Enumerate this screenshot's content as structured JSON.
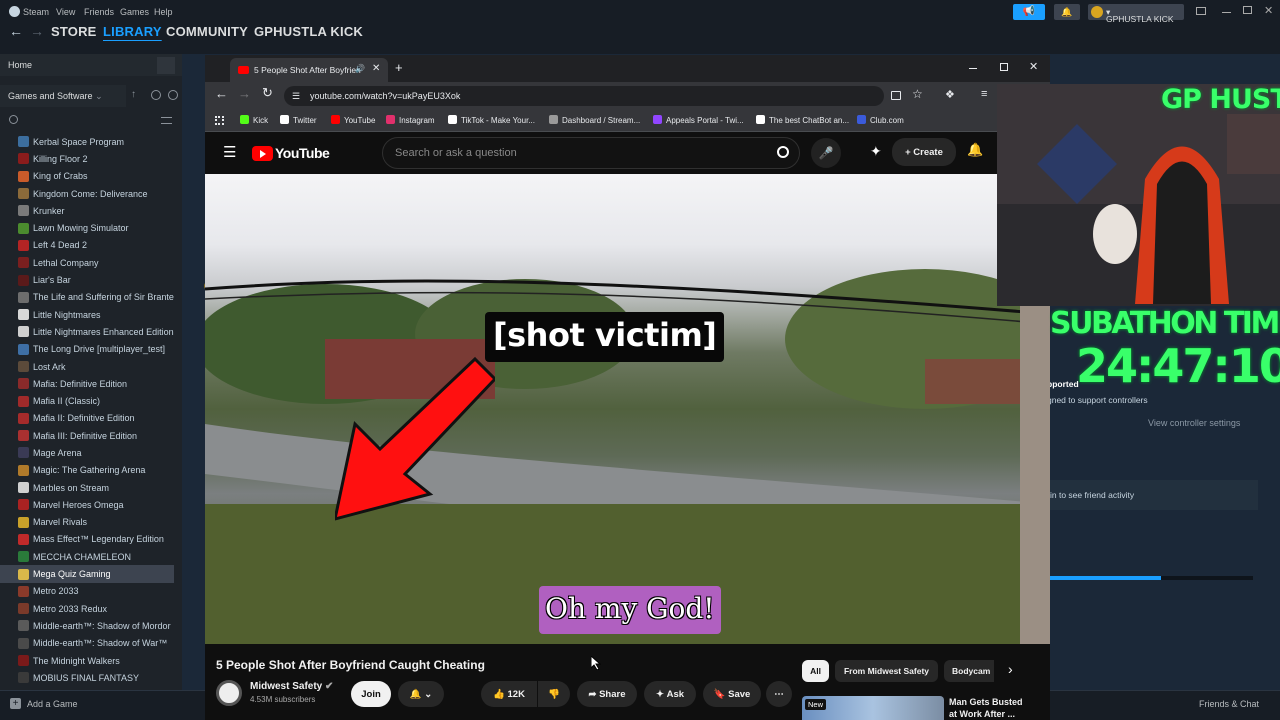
{
  "steam": {
    "menubar": [
      "Steam",
      "View",
      "Friends",
      "Games",
      "Help"
    ],
    "nav": [
      "STORE",
      "LIBRARY",
      "COMMUNITY",
      "GPHUSTLA KICK"
    ],
    "active_nav": "LIBRARY",
    "username": "GPHUSTLA KICK",
    "sidebar": {
      "home": "Home",
      "filter": "Games and Software",
      "games": [
        {
          "name": "Kerbal Space Program",
          "color": "#3c6e9e"
        },
        {
          "name": "Killing Floor 2",
          "color": "#8a1c1c"
        },
        {
          "name": "King of Crabs",
          "color": "#c95b2a"
        },
        {
          "name": "Kingdom Come: Deliverance",
          "color": "#8b6a3a"
        },
        {
          "name": "Krunker",
          "color": "#7a7a7a"
        },
        {
          "name": "Lawn Mowing Simulator",
          "color": "#4b8b2e"
        },
        {
          "name": "Left 4 Dead 2",
          "color": "#b32424"
        },
        {
          "name": "Lethal Company",
          "color": "#7a1f1f"
        },
        {
          "name": "Liar's Bar",
          "color": "#5a1a1a"
        },
        {
          "name": "The Life and Suffering of Sir Brante",
          "color": "#6d6d6d"
        },
        {
          "name": "Little Nightmares",
          "color": "#d8d8d8"
        },
        {
          "name": "Little Nightmares Enhanced Edition",
          "color": "#cfcfcf"
        },
        {
          "name": "The Long Drive [multiplayer_test]",
          "color": "#3e6fa5"
        },
        {
          "name": "Lost Ark",
          "color": "#5b4a3a"
        },
        {
          "name": "Mafia: Definitive Edition",
          "color": "#8a2a2a"
        },
        {
          "name": "Mafia II (Classic)",
          "color": "#a02a2a"
        },
        {
          "name": "Mafia II: Definitive Edition",
          "color": "#a52b2b"
        },
        {
          "name": "Mafia III: Definitive Edition",
          "color": "#a83030"
        },
        {
          "name": "Mage Arena",
          "color": "#3a3a55"
        },
        {
          "name": "Magic: The Gathering Arena",
          "color": "#b07a2a"
        },
        {
          "name": "Marbles on Stream",
          "color": "#d0d0d0"
        },
        {
          "name": "Marvel Heroes Omega",
          "color": "#a22"
        },
        {
          "name": "Marvel Rivals",
          "color": "#c9a12a"
        },
        {
          "name": "Mass Effect™ Legendary Edition",
          "color": "#c02a2a"
        },
        {
          "name": "MECCHA CHAMELEON",
          "color": "#2a7a3a"
        },
        {
          "name": "Mega Quiz Gaming",
          "color": "#d9b84a"
        },
        {
          "name": "Metro 2033",
          "color": "#8a3a2a"
        },
        {
          "name": "Metro 2033 Redux",
          "color": "#7a3a2a"
        },
        {
          "name": "Middle-earth™: Shadow of Mordor",
          "color": "#5a5a5a"
        },
        {
          "name": "Middle-earth™: Shadow of War™",
          "color": "#4a4a4a"
        },
        {
          "name": "The Midnight Walkers",
          "color": "#7a1a1a"
        },
        {
          "name": "MOBIUS FINAL FANTASY",
          "color": "#3a3a3a"
        }
      ],
      "selected_game": "Mega Quiz Gaming",
      "add_game": "Add a Game"
    },
    "right_panel": {
      "supported": "pported",
      "supported_sub": "gned to support controllers",
      "view_controller": "View controller settings",
      "friend_activity": "in to see friend activity",
      "friends_chat": "Friends & Chat",
      "progress": 0.55
    }
  },
  "browser": {
    "tab_title": "5 People Shot After Boyfrien",
    "url": "youtube.com/watch?v=ukPayEU3Xok",
    "bookmarks": [
      {
        "label": "Kick",
        "color": "#53fc18"
      },
      {
        "label": "Twitter",
        "color": "#ffffff"
      },
      {
        "label": "YouTube",
        "color": "#ff0000"
      },
      {
        "label": "Instagram",
        "color": "#e1306c"
      },
      {
        "label": "TikTok - Make Your...",
        "color": "#ffffff"
      },
      {
        "label": "Dashboard / Stream...",
        "color": "#9a9a9a"
      },
      {
        "label": "Appeals Portal - Twi...",
        "color": "#9146ff"
      },
      {
        "label": "The best ChatBot an...",
        "color": "#ffffff"
      },
      {
        "label": "Club.com",
        "color": "#3b5bdb"
      }
    ]
  },
  "youtube": {
    "logo": "YouTube",
    "search_placeholder": "Search or ask a question",
    "create": "Create",
    "caption_top": "[shot victim]",
    "caption_bottom": "Oh my God!",
    "video_title": "5 People Shot After Boyfriend Caught Cheating",
    "channel": "Midwest Safety",
    "subscribers": "4.53M subscribers",
    "join": "Join",
    "likes": "12K",
    "share": "Share",
    "ask": "Ask",
    "save": "Save",
    "chips": [
      "All",
      "From Midwest Safety",
      "Bodycam"
    ],
    "rec_badge": "New",
    "rec_title": "Man Gets Busted at Work After ..."
  },
  "overlay": {
    "name": "GP HUSTLA",
    "subathon_label": "SUBATHON TIMER",
    "timer": "24:47:10"
  }
}
